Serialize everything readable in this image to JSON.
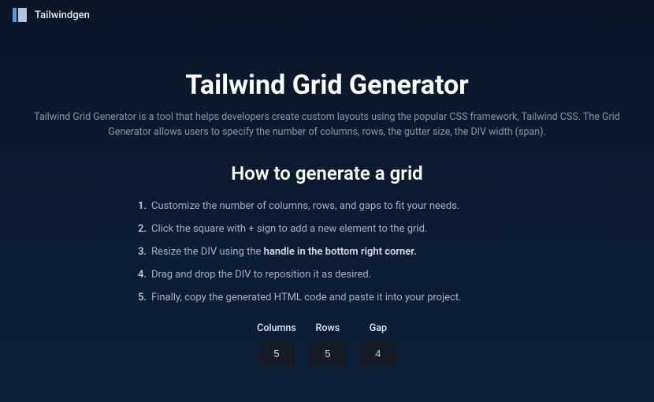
{
  "header": {
    "brand": "Tailwindgen"
  },
  "main": {
    "title": "Tailwind Grid Generator",
    "description": "Tailwind Grid Generator is a tool that helps developers create custom layouts using the popular CSS framework, Tailwind CSS. The Grid Generator allows users to specify the number of columns, rows, the gutter size, the DIV width (span).",
    "subtitle": "How to generate a grid",
    "steps": [
      {
        "num": "1.",
        "text": "Customize the number of columns, rows, and gaps to fit your needs."
      },
      {
        "num": "2.",
        "text": "Click the square with + sign to add a new element to the grid."
      },
      {
        "num": "3.",
        "text_before": "Resize the DIV using the ",
        "bold": "handle in the bottom right corner."
      },
      {
        "num": "4.",
        "text": "Drag and drop the DIV to reposition it as desired."
      },
      {
        "num": "5.",
        "text": "Finally, copy the generated HTML code and paste it into your project."
      }
    ],
    "controls": {
      "columns": {
        "label": "Columns",
        "value": "5"
      },
      "rows": {
        "label": "Rows",
        "value": "5"
      },
      "gap": {
        "label": "Gap",
        "value": "4"
      }
    }
  }
}
